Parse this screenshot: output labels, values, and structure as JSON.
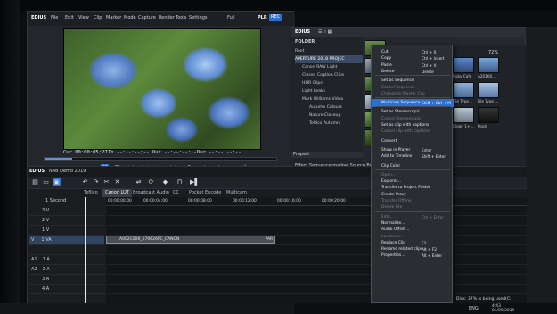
{
  "player": {
    "app_name": "EDIUS",
    "menu": [
      "File",
      "Edit",
      "View",
      "Clip",
      "Marker",
      "Mode",
      "Capture",
      "Render",
      "Tools",
      "Settings"
    ],
    "zoom": "Full",
    "mode_label": "PLR",
    "rec_label": "REC",
    "timecode_cur": "Cur 00:00:05;27",
    "timecode_in": "In --:--:--;--",
    "timecode_out": "Out --:--:--;--",
    "timecode_dur": "Dur --:--:--;--",
    "scrub_progress": 0.12,
    "cc_label": "CC"
  },
  "recorder": {
    "title": "EDIUS",
    "project": "NAB Demo 2019",
    "tabs": [
      "Teflico",
      "Canon LUT",
      "Broadcast Audio",
      "CC",
      "Pocket Encode",
      "Multicam"
    ],
    "active_tab": 1,
    "ruler_start": "00:00:00;00",
    "ruler_marks": [
      "00:00:04;00",
      "00:00:08;00",
      "00:00:12;00",
      "00:00:16;00",
      "00:00:20;00"
    ],
    "zoom_label": "1 Second",
    "tracks": [
      {
        "label": "3 V"
      },
      {
        "label": "2 V"
      },
      {
        "label": "1 V"
      },
      {
        "label": "1 VA"
      },
      {
        "label": "1 A"
      },
      {
        "label": "2 A"
      },
      {
        "label": "3 A"
      },
      {
        "label": "4 A"
      }
    ],
    "track_side_labels": {
      "v": "V",
      "a1": "A1",
      "a2": "A2"
    },
    "clip_name": "A002C006_170626PC_CANON",
    "clip_tag": "PAR"
  },
  "bin": {
    "title": "EDIUS",
    "folder_header": "FOLDER",
    "folders": [
      {
        "label": "Root",
        "selected": false
      },
      {
        "label": "APERTURE 2018 PROJEC",
        "selected": true
      },
      {
        "label": "Canon RAW Light",
        "selected": false
      },
      {
        "label": "Closed Caption Clips",
        "selected": false
      },
      {
        "label": "HDR Clips",
        "selected": false
      },
      {
        "label": "Light Leaks",
        "selected": false
      },
      {
        "label": "Mark Williams Video",
        "selected": false
      },
      {
        "label": "Autumn Colours",
        "selected": false
      },
      {
        "label": "Nature Closeup",
        "selected": false
      },
      {
        "label": "Teflico Autumn",
        "selected": false
      }
    ],
    "status": "Effect  Sequence marker  Source Browser",
    "properties": "Propert"
  },
  "context_menu": {
    "items": [
      {
        "label": "Cut",
        "shortcut": "Ctrl + X",
        "disabled": false
      },
      {
        "label": "Copy",
        "shortcut": "Ctrl + Insert",
        "disabled": false
      },
      {
        "label": "Paste",
        "shortcut": "Ctrl + V",
        "disabled": false
      },
      {
        "label": "Delete",
        "shortcut": "Delete",
        "disabled": false
      },
      {
        "sep": true
      },
      {
        "label": "Set as Sequence",
        "shortcut": "",
        "disabled": false
      },
      {
        "label": "Cancel Sequence",
        "shortcut": "",
        "disabled": true
      },
      {
        "label": "Change to Master Clip",
        "shortcut": "",
        "disabled": true
      },
      {
        "sep": true
      },
      {
        "label": "Multicam Sequence",
        "shortcut": "Shift + Ctrl + M",
        "disabled": false,
        "highlight": true
      },
      {
        "sep": true
      },
      {
        "label": "Set as Stereoscopic...",
        "shortcut": "",
        "disabled": false
      },
      {
        "label": "Cancel Stereoscopic",
        "shortcut": "",
        "disabled": true
      },
      {
        "label": "Set as clip with captions",
        "shortcut": "",
        "disabled": false
      },
      {
        "label": "Cancel clip with captions",
        "shortcut": "",
        "disabled": true
      },
      {
        "sep": true
      },
      {
        "label": "Convert",
        "shortcut": "",
        "disabled": false
      },
      {
        "sep": true
      },
      {
        "label": "Show in Player",
        "shortcut": "Enter",
        "disabled": false
      },
      {
        "label": "Add to Timeline",
        "shortcut": "Shift + Enter",
        "disabled": false
      },
      {
        "sep": true
      },
      {
        "label": "Clip Color",
        "shortcut": "",
        "disabled": false
      },
      {
        "sep": true
      },
      {
        "label": "Open...",
        "shortcut": "",
        "disabled": true
      },
      {
        "label": "Explorer...",
        "shortcut": "",
        "disabled": false
      },
      {
        "label": "Transfer to Project Folder",
        "shortcut": "",
        "disabled": false
      },
      {
        "label": "Create Proxy",
        "shortcut": "",
        "disabled": false
      },
      {
        "label": "Transfer Offline",
        "shortcut": "",
        "disabled": true
      },
      {
        "label": "Delete File",
        "shortcut": "",
        "disabled": true
      },
      {
        "sep": true
      },
      {
        "label": "Edit...",
        "shortcut": "Ctrl + Enter",
        "disabled": true
      },
      {
        "label": "Normalize...",
        "shortcut": "",
        "disabled": false
      },
      {
        "label": "Audio Offset...",
        "shortcut": "",
        "disabled": false
      },
      {
        "label": "Loudness...",
        "shortcut": "",
        "disabled": true
      },
      {
        "label": "Replace Clip",
        "shortcut": "F3",
        "disabled": false
      },
      {
        "label": "Rename related clips...",
        "shortcut": "Alt + F2",
        "disabled": false
      },
      {
        "label": "Properties...",
        "shortcut": "Alt + Enter",
        "disabled": false
      }
    ]
  },
  "browser": {
    "zoom": "72%",
    "items": [
      "Ruby Cafe",
      "A20160...",
      "File Type 1",
      "File Type ...",
      "Clean 1+1..",
      "Pooh"
    ],
    "disk_status": "Disk: 37% is being used(C:)"
  },
  "taskbar": {
    "lang": "ENG",
    "time": "4:43",
    "date": "04/09/2019"
  },
  "colors": {
    "accent": "#2f6fcf",
    "timeline_bg": "#131518",
    "panel": "#23262b"
  }
}
